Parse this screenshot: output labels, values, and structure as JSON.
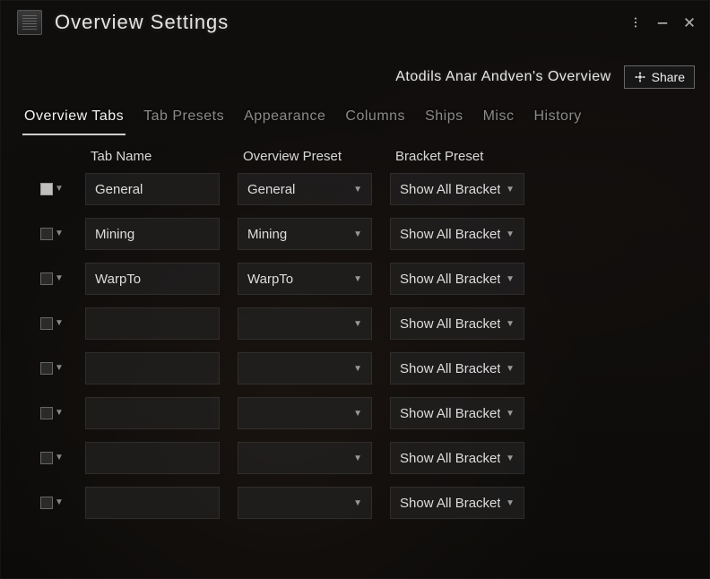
{
  "window": {
    "title": "Overview Settings"
  },
  "subheader": {
    "owner": "Atodils Anar Andven's Overview",
    "share_label": "Share"
  },
  "tabs": [
    {
      "label": "Overview Tabs",
      "active": true
    },
    {
      "label": "Tab Presets",
      "active": false
    },
    {
      "label": "Appearance",
      "active": false
    },
    {
      "label": "Columns",
      "active": false
    },
    {
      "label": "Ships",
      "active": false
    },
    {
      "label": "Misc",
      "active": false
    },
    {
      "label": "History",
      "active": false
    }
  ],
  "columns": {
    "name": "Tab Name",
    "overview_preset": "Overview Preset",
    "bracket_preset": "Bracket Preset"
  },
  "rows": [
    {
      "color": "light",
      "name": "General",
      "preset": "General",
      "bracket": "Show All Brackets"
    },
    {
      "color": "dark",
      "name": "Mining",
      "preset": "Mining",
      "bracket": "Show All Brackets"
    },
    {
      "color": "dark",
      "name": "WarpTo",
      "preset": "WarpTo",
      "bracket": "Show All Brackets"
    },
    {
      "color": "dark",
      "name": "",
      "preset": "",
      "bracket": "Show All Brackets"
    },
    {
      "color": "dark",
      "name": "",
      "preset": "",
      "bracket": "Show All Brackets"
    },
    {
      "color": "dark",
      "name": "",
      "preset": "",
      "bracket": "Show All Brackets"
    },
    {
      "color": "dark",
      "name": "",
      "preset": "",
      "bracket": "Show All Brackets"
    },
    {
      "color": "dark",
      "name": "",
      "preset": "",
      "bracket": "Show All Brackets"
    }
  ]
}
